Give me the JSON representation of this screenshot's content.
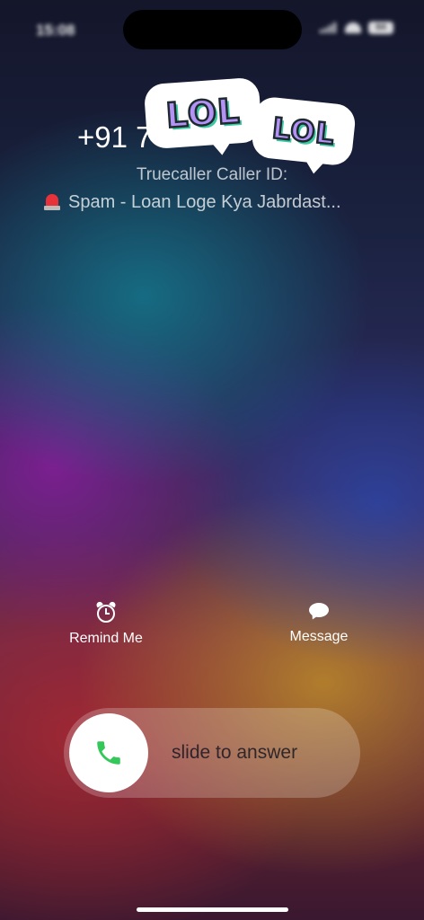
{
  "status_bar": {
    "time": "15:08",
    "battery": "64"
  },
  "call": {
    "number": "+91 7",
    "caller_id_label": "Truecaller Caller ID:",
    "spam_text": "Spam - Loan Loge Kya Jabrdast...",
    "spam_icon": "siren-icon"
  },
  "stickers": [
    {
      "text": "LOL",
      "fill_color": "#b392f5",
      "shadow_color": "#3cc8a0"
    },
    {
      "text": "LOL",
      "fill_color": "#b392f5",
      "shadow_color": "#3cc8a0"
    }
  ],
  "actions": {
    "remind_me": {
      "label": "Remind Me",
      "icon": "alarm-clock-icon"
    },
    "message": {
      "label": "Message",
      "icon": "speech-bubble-icon"
    }
  },
  "slider": {
    "label": "slide to answer",
    "icon": "phone-icon",
    "icon_color": "#34c759"
  }
}
